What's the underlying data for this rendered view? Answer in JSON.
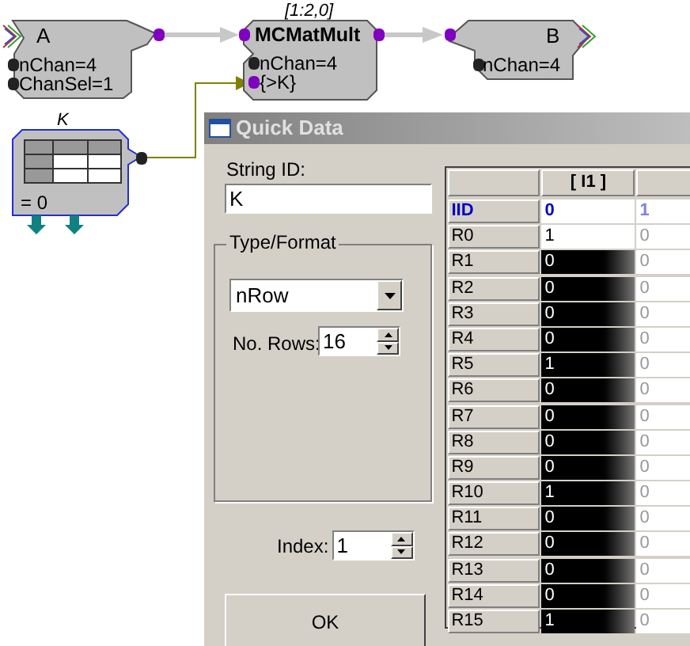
{
  "nodes": [
    {
      "kind": "input",
      "title": "A",
      "params": [
        "nChan=4",
        "ChanSel=1"
      ]
    },
    {
      "kind": "process",
      "title": "MCMatMult",
      "caption": "[1:2,0]",
      "params": [
        "nChan=4",
        "{>K}"
      ]
    },
    {
      "kind": "output",
      "title": "B",
      "params": [
        "nChan=4"
      ]
    },
    {
      "kind": "matrix",
      "caption": "K",
      "value": "= 0"
    }
  ],
  "dialog": {
    "title": "Quick Data",
    "string_id": {
      "label": "String ID:",
      "value": "K"
    },
    "type_format": {
      "label": "Type/Format",
      "dropdown": "nRow",
      "rows_label": "No. Rows:",
      "rows_value": "16"
    },
    "index": {
      "label": "Index:",
      "value": "1"
    },
    "ok": "OK",
    "table": {
      "columns": [
        "[ I1 ]"
      ],
      "index_row": {
        "label": "IID",
        "values": [
          "0",
          "1"
        ]
      },
      "rows": [
        {
          "label": "R0",
          "values": [
            "1",
            "0"
          ],
          "selected": false
        },
        {
          "label": "R1",
          "values": [
            "0",
            "0"
          ],
          "selected": true
        },
        {
          "label": "R2",
          "values": [
            "0",
            "0"
          ],
          "selected": true
        },
        {
          "label": "R3",
          "values": [
            "0",
            "0"
          ],
          "selected": true
        },
        {
          "label": "R4",
          "values": [
            "0",
            "0"
          ],
          "selected": true
        },
        {
          "label": "R5",
          "values": [
            "1",
            "0"
          ],
          "selected": true
        },
        {
          "label": "R6",
          "values": [
            "0",
            "0"
          ],
          "selected": true
        },
        {
          "label": "R7",
          "values": [
            "0",
            "0"
          ],
          "selected": true
        },
        {
          "label": "R8",
          "values": [
            "0",
            "0"
          ],
          "selected": true
        },
        {
          "label": "R9",
          "values": [
            "0",
            "0"
          ],
          "selected": true
        },
        {
          "label": "R10",
          "values": [
            "1",
            "0"
          ],
          "selected": true
        },
        {
          "label": "R11",
          "values": [
            "0",
            "0"
          ],
          "selected": true
        },
        {
          "label": "R12",
          "values": [
            "0",
            "0"
          ],
          "selected": true
        },
        {
          "label": "R13",
          "values": [
            "0",
            "0"
          ],
          "selected": true
        },
        {
          "label": "R14",
          "values": [
            "0",
            "0"
          ],
          "selected": true
        },
        {
          "label": "R15",
          "values": [
            "1",
            "0"
          ],
          "selected": true
        }
      ]
    }
  }
}
